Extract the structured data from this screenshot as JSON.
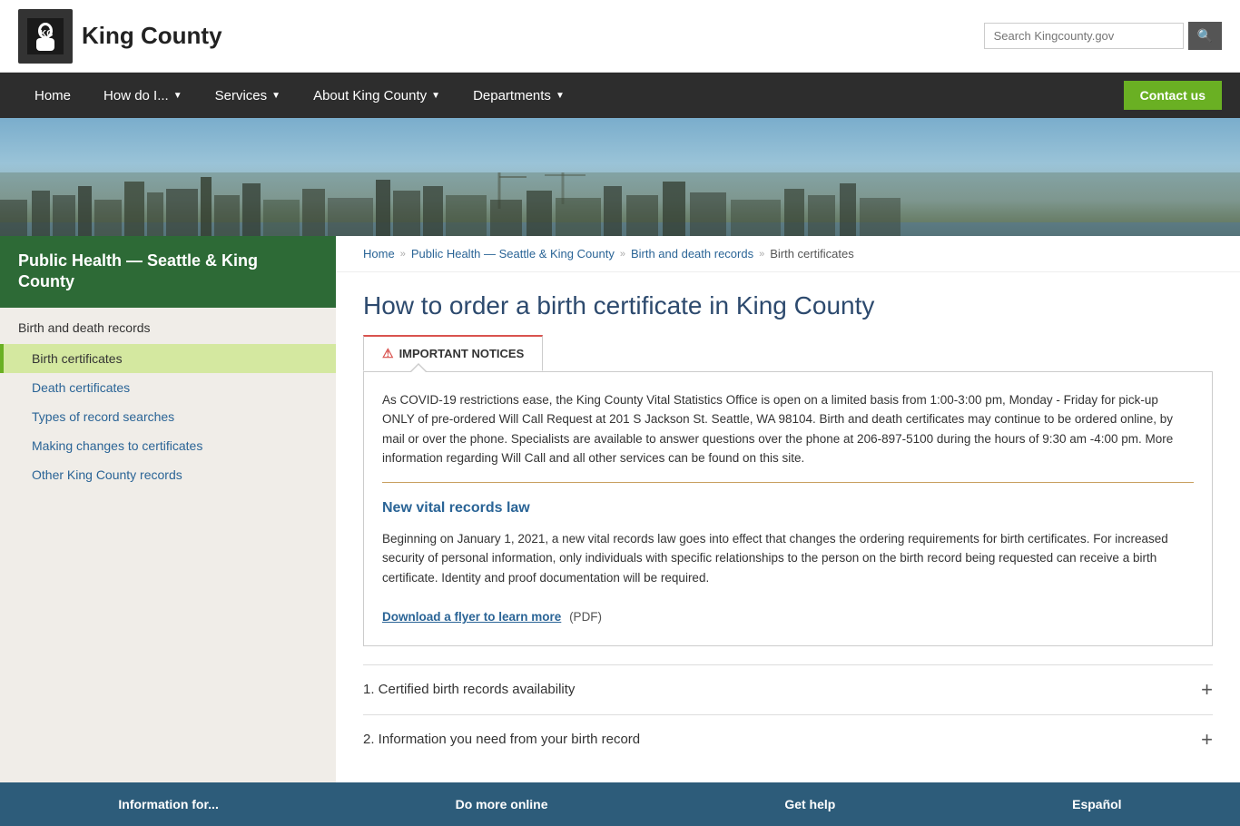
{
  "header": {
    "logo_text": "King County",
    "logo_icon": "👤",
    "search_placeholder": "Search Kingcounty.gov"
  },
  "nav": {
    "items": [
      {
        "label": "Home",
        "id": "home",
        "has_dropdown": false
      },
      {
        "label": "How do I...",
        "id": "how-do-i",
        "has_dropdown": true
      },
      {
        "label": "Services",
        "id": "services",
        "has_dropdown": true
      },
      {
        "label": "About King County",
        "id": "about",
        "has_dropdown": true
      },
      {
        "label": "Departments",
        "id": "departments",
        "has_dropdown": true
      }
    ],
    "cta_label": "Contact us"
  },
  "breadcrumb": {
    "items": [
      {
        "label": "Home",
        "id": "home"
      },
      {
        "label": "Public Health — Seattle & King County",
        "id": "public-health"
      },
      {
        "label": "Birth and death records",
        "id": "birth-death"
      },
      {
        "label": "Birth certificates",
        "id": "birth-cert"
      }
    ]
  },
  "sidebar": {
    "title": "Public Health — Seattle & King County",
    "section_title": "Birth and death records",
    "items": [
      {
        "label": "Birth certificates",
        "id": "birth-cert",
        "active": true
      },
      {
        "label": "Death certificates",
        "id": "death-cert"
      },
      {
        "label": "Types of record searches",
        "id": "types-search"
      },
      {
        "label": "Making changes to certificates",
        "id": "making-changes"
      },
      {
        "label": "Other King County records",
        "id": "other-records"
      }
    ]
  },
  "page": {
    "title": "How to order a birth certificate in King County",
    "tab_label": "IMPORTANT NOTICES",
    "notice_text": "As COVID-19 restrictions ease, the King County Vital Statistics Office is open on a limited basis from 1:00-3:00 pm, Monday - Friday for pick-up ONLY of pre-ordered Will Call Request at 201 S Jackson St. Seattle, WA 98104. Birth and death certificates may continue to be ordered online, by mail or over the phone. Specialists are available to answer questions over the phone at 206-897-5100 during the hours of 9:30 am -4:00 pm. More information regarding Will Call and all other services can be found on this site.",
    "notice_subtitle": "New vital records law",
    "notice_body": "Beginning on January 1, 2021, a new vital records law goes into effect that changes the ordering requirements for birth certificates. For increased security of personal information, only individuals with specific relationships to the person on the birth record being requested can receive a birth certificate. Identity and proof documentation will be required.",
    "download_link": "Download a flyer to learn more",
    "download_suffix": "(PDF)",
    "accordion_items": [
      {
        "label": "1. Certified birth records availability",
        "id": "accordion-1"
      },
      {
        "label": "2. Information you need from your birth record",
        "id": "accordion-2"
      }
    ]
  },
  "footer": {
    "items": [
      {
        "label": "Information for..."
      },
      {
        "label": "Do more online"
      },
      {
        "label": "Get help"
      },
      {
        "label": "Español"
      }
    ]
  }
}
